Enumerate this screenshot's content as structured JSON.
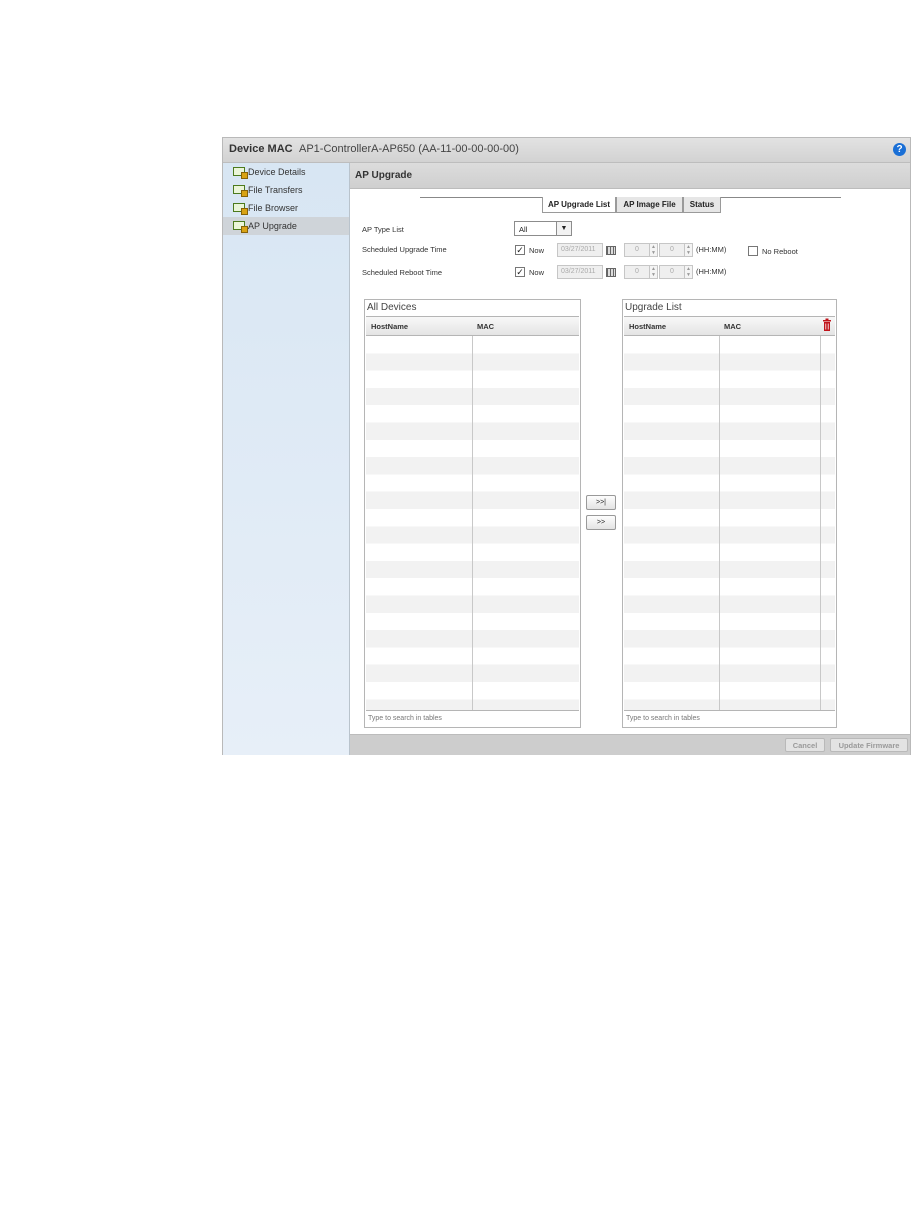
{
  "header": {
    "label": "Device MAC",
    "device": "AP1-ControllerA-AP650 (AA-11-00-00-00-00)"
  },
  "sidebar": {
    "items": [
      {
        "label": "Device Details"
      },
      {
        "label": "File Transfers"
      },
      {
        "label": "File Browser"
      },
      {
        "label": "AP Upgrade"
      }
    ]
  },
  "section": {
    "title": "AP Upgrade"
  },
  "tabs": [
    {
      "label": "AP Upgrade List"
    },
    {
      "label": "AP Image File"
    },
    {
      "label": "Status"
    }
  ],
  "form": {
    "ap_type_label": "AP Type List",
    "ap_type_value": "All",
    "upgrade_label": "Scheduled Upgrade Time",
    "reboot_label": "Scheduled Reboot Time",
    "now_label": "Now",
    "date_value": "03/27/2011",
    "hour_value": "0",
    "minute_value": "0",
    "time_format": "(HH:MM)",
    "no_reboot_label": "No Reboot"
  },
  "all_devices": {
    "title": "All Devices",
    "columns": [
      "HostName",
      "MAC"
    ],
    "search_placeholder": "Type to search in tables"
  },
  "upgrade_list": {
    "title": "Upgrade List",
    "columns": [
      "HostName",
      "MAC"
    ],
    "search_placeholder": "Type to search in tables"
  },
  "move_buttons": {
    "move_all": ">>|",
    "move_selected": ">>"
  },
  "footer": {
    "cancel": "Cancel",
    "update": "Update Firmware"
  },
  "colors": {
    "accent": "#1a6fd6",
    "trash": "#c0141b"
  }
}
